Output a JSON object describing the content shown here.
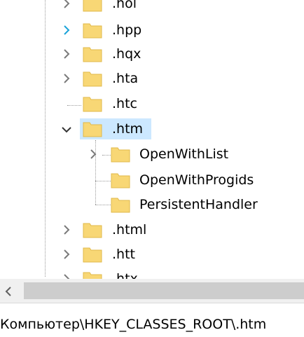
{
  "tree": {
    "items": [
      {
        "label": ".hol",
        "expander": "collapsed"
      },
      {
        "label": ".hpp",
        "expander": "collapsed-hover"
      },
      {
        "label": ".hqx",
        "expander": "collapsed"
      },
      {
        "label": ".hta",
        "expander": "collapsed"
      },
      {
        "label": ".htc",
        "expander": "none"
      },
      {
        "label": ".htm",
        "expander": "expanded",
        "selected": true
      },
      {
        "label": "OpenWithList",
        "expander": "collapsed",
        "child": true
      },
      {
        "label": "OpenWithProgids",
        "expander": "none",
        "child": true
      },
      {
        "label": "PersistentHandler",
        "expander": "none",
        "child": true
      },
      {
        "label": ".html",
        "expander": "collapsed"
      },
      {
        "label": ".htt",
        "expander": "collapsed"
      },
      {
        "label": ".htx",
        "expander": "collapsed"
      }
    ]
  },
  "statusbar": {
    "path": "Компьютер\\HKEY_CLASSES_ROOT\\.htm"
  },
  "colors": {
    "selection": "#cce8ff",
    "folder": "#f8d775",
    "folder_edge": "#e0b84a",
    "chevron": "#7a7a7a",
    "chevron_hover": "#1aa3d9"
  },
  "icons": {
    "folder": "folder-icon",
    "collapsed": "chevron-right-icon",
    "expanded": "chevron-down-icon",
    "scroll_left": "scroll-left-arrow-icon"
  }
}
